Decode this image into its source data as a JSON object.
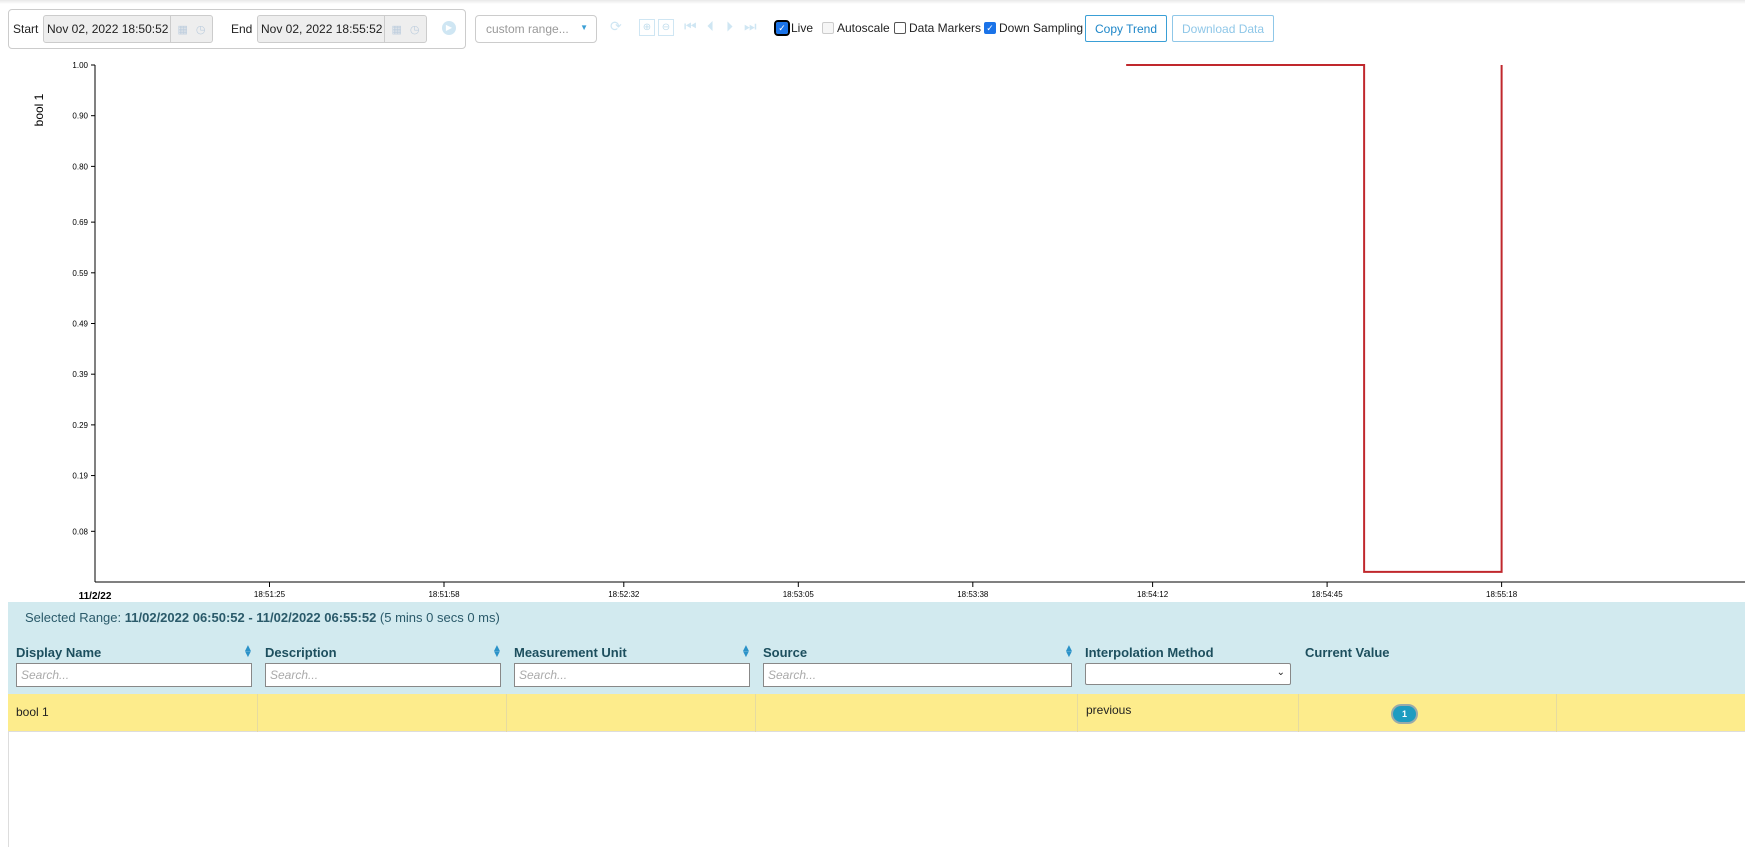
{
  "toolbar": {
    "start_label": "Start",
    "start_value": "Nov 02, 2022 18:50:52",
    "end_label": "End",
    "end_value": "Nov 02, 2022 18:55:52",
    "range_placeholder": "custom range...",
    "live_label": "Live",
    "live_checked": true,
    "autoscale_label": "Autoscale",
    "autoscale_checked": false,
    "data_markers_label": "Data Markers",
    "data_markers_checked": false,
    "down_sampling_label": "Down Sampling",
    "down_sampling_checked": true,
    "copy_trend_label": "Copy Trend",
    "download_data_label": "Download Data"
  },
  "chart_data": {
    "type": "line",
    "interpolation": "step",
    "ylabel": "bool 1",
    "date_label": "11/2/22",
    "xlim": [
      "18:50:52",
      "18:55:52"
    ],
    "ylim": [
      -0.02,
      1.0
    ],
    "y_ticks": [
      "1.00",
      "0.90",
      "0.80",
      "0.69",
      "0.59",
      "0.49",
      "0.39",
      "0.29",
      "0.19",
      "0.08"
    ],
    "x_ticks": [
      "18:51:25",
      "18:51:58",
      "18:52:32",
      "18:53:05",
      "18:53:38",
      "18:54:12",
      "18:54:45",
      "18:55:18"
    ],
    "series": [
      {
        "color": "#c0282d",
        "points": [
          [
            "18:54:07",
            1
          ],
          [
            "18:54:52",
            1
          ],
          [
            "18:54:52",
            0
          ],
          [
            "18:55:18",
            0
          ],
          [
            "18:55:18",
            1
          ]
        ]
      }
    ]
  },
  "selected_range": {
    "label": "Selected Range:",
    "value": "11/02/2022 06:50:52 - 11/02/2022 06:55:52",
    "duration": "(5 mins 0 secs 0 ms)"
  },
  "table": {
    "columns": [
      "Display Name",
      "Description",
      "Measurement Unit",
      "Source",
      "Interpolation Method",
      "Current Value"
    ],
    "search_placeholder": "Search...",
    "rows": [
      {
        "display_name": "bool 1",
        "description": "",
        "unit": "",
        "source": "",
        "interpolation": "previous",
        "current_value": "1"
      }
    ]
  }
}
